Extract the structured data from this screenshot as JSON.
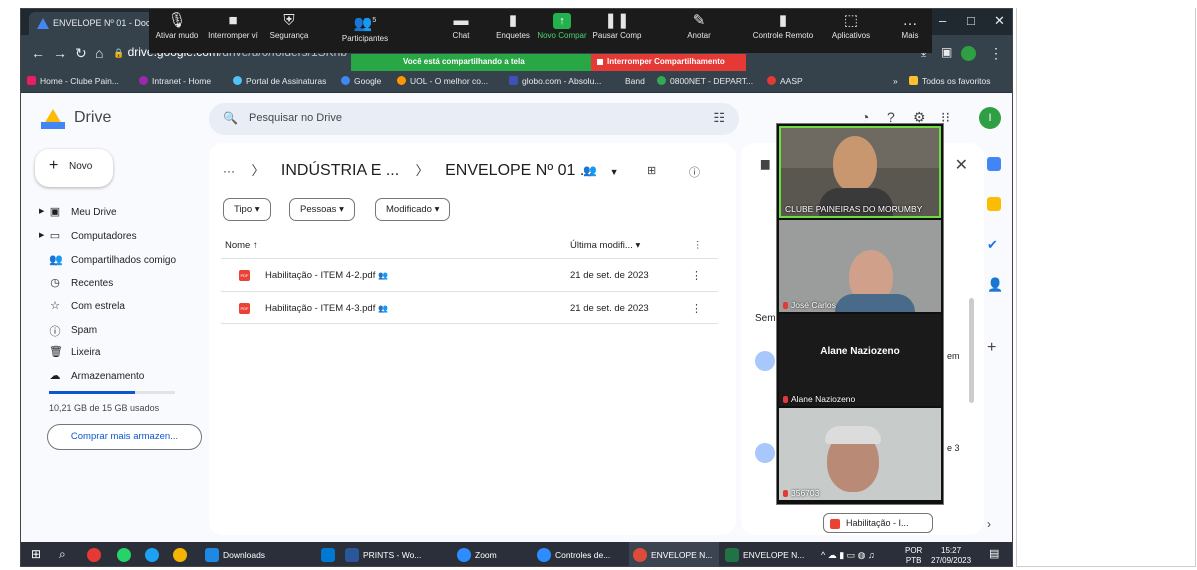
{
  "browser": {
    "tab_title": "ENVELOPE Nº 01 - Doc",
    "url_domain": "drive.google.com",
    "url_path": "/drive/u/0/folders/1SKnb",
    "window_controls": [
      "–",
      "□",
      "✕"
    ]
  },
  "zoom_toolbar": {
    "items": [
      {
        "label": "Ativar mudo",
        "glyph": "🎙"
      },
      {
        "label": "Interromper ví",
        "glyph": "■"
      },
      {
        "label": "Segurança",
        "glyph": "⛨"
      },
      {
        "label": "Participantes",
        "glyph": "👥",
        "count": "5"
      },
      {
        "label": "Chat",
        "glyph": "▬"
      },
      {
        "label": "Enquetes",
        "glyph": "▮"
      },
      {
        "label": "Novo Compar",
        "glyph": "↑"
      },
      {
        "label": "Pausar Comp",
        "glyph": "❚❚"
      },
      {
        "label": "Anotar",
        "glyph": "✎"
      },
      {
        "label": "Controle Remoto",
        "glyph": "▮"
      },
      {
        "label": "Aplicativos",
        "glyph": "⬚"
      },
      {
        "label": "Mais",
        "glyph": "…"
      }
    ],
    "sharing_text": "Você está compartilhando a tela",
    "stop_sharing": "Interromper Compartilhamento"
  },
  "bookmarks": [
    {
      "label": "Home - Clube Pain...",
      "color": "#e91e63"
    },
    {
      "label": "Intranet - Home",
      "color": "#9c27b0"
    },
    {
      "label": "Portal de Assinaturas",
      "color": "#4fc3f7"
    },
    {
      "label": "Google",
      "color": "#4285f4"
    },
    {
      "label": "UOL - O melhor co...",
      "color": "#ff9800"
    },
    {
      "label": "globo.com - Absolu...",
      "color": "#3f51b5"
    },
    {
      "label": "Band",
      "color": "#455a64"
    },
    {
      "label": "0800NET - DEPART...",
      "color": "#34a853"
    },
    {
      "label": "AASP",
      "color": "#e53935"
    }
  ],
  "bookmarks_more": "»",
  "bookmarks_all": "Todos os favoritos",
  "drive": {
    "brand": "Drive",
    "search_placeholder": "Pesquisar no Drive",
    "new_label": "Novo",
    "sidebar": [
      {
        "label": "Meu Drive",
        "icon": "drive-icon",
        "glyph": "▣",
        "expandable": true
      },
      {
        "label": "Computadores",
        "icon": "computer-icon",
        "glyph": "▭",
        "expandable": true
      },
      {
        "label": "Compartilhados comigo",
        "icon": "people-icon",
        "glyph": "👥"
      },
      {
        "label": "Recentes",
        "icon": "clock-icon",
        "glyph": "◷"
      },
      {
        "label": "Com estrela",
        "icon": "star-icon",
        "glyph": "☆"
      },
      {
        "label": "Spam",
        "icon": "spam-icon",
        "glyph": "ⓘ"
      },
      {
        "label": "Lixeira",
        "icon": "trash-icon",
        "glyph": "🗑"
      },
      {
        "label": "Armazenamento",
        "icon": "cloud-icon",
        "glyph": "☁"
      }
    ],
    "storage_used_fraction": 0.68,
    "storage_text": "10,21 GB de 15 GB usados",
    "buy_storage": "Comprar mais armazen...",
    "breadcrumb": {
      "more": "···",
      "parent": "INDÚSTRIA E ...",
      "current": "ENVELOPE Nº 01 ..."
    },
    "filters": [
      "Tipo ▾",
      "Pessoas ▾",
      "Modificado ▾"
    ],
    "columns": {
      "name": "Nome ↑",
      "modified": "Última modifi... ▾"
    },
    "files": [
      {
        "name": "Habilitação - ITEM 4-2.pdf",
        "modified": "21 de set. de 2023"
      },
      {
        "name": "Habilitação - ITEM 4-3.pdf",
        "modified": "21 de set. de 2023"
      }
    ],
    "details": {
      "partial_text": "Sem",
      "chip": "Habilitação - I...",
      "right_frag_1": "em",
      "right_frag_2": "e 3"
    },
    "avatar_letter": "I"
  },
  "zoom_gallery": [
    {
      "name": "CLUBE PAINEIRAS DO MORUMBY",
      "video": true,
      "active": true,
      "muted": false
    },
    {
      "name": "José Carlos",
      "video": true,
      "active": false,
      "muted": true
    },
    {
      "name": "Alane Naziozeno",
      "video": false,
      "active": false,
      "muted": true,
      "center": "Alane Naziozeno"
    },
    {
      "name": "356703",
      "video": true,
      "active": false,
      "muted": true
    }
  ],
  "taskbar": {
    "items": [
      {
        "label": "Downloads",
        "color": "#1e88e5"
      },
      {
        "label": "PRINTS - Wo...",
        "color": "#2b579a"
      },
      {
        "label": "Zoom",
        "color": "#2d8cff"
      },
      {
        "label": "Controles de...",
        "color": "#2d8cff"
      },
      {
        "label": "ENVELOPE N...",
        "color": "#dd4b39"
      },
      {
        "label": "ENVELOPE N...",
        "color": "#217346"
      }
    ],
    "lang": "POR",
    "lang2": "PTB",
    "time": "15:27",
    "date": "27/09/2023"
  }
}
